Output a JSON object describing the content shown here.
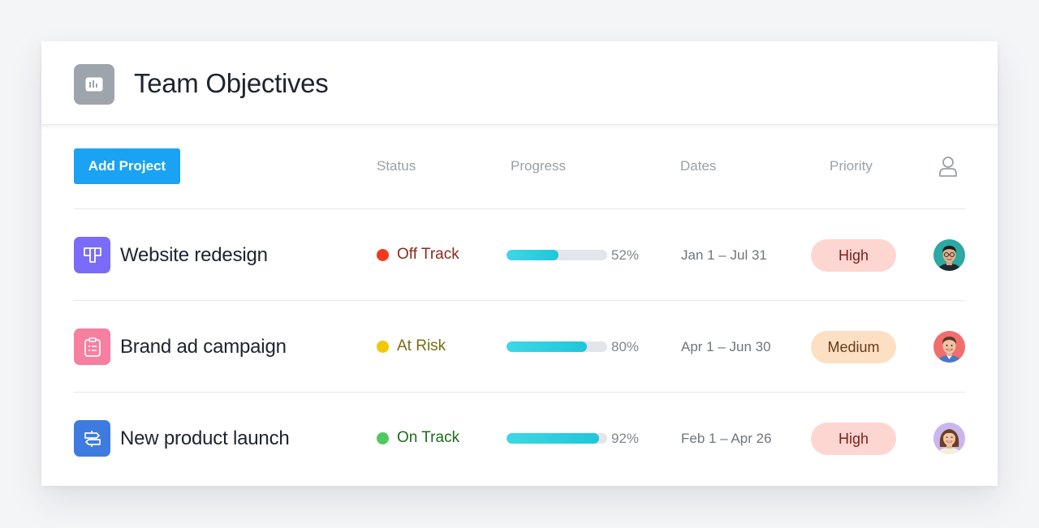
{
  "header": {
    "title": "Team Objectives",
    "icon": "bar-chart-icon"
  },
  "toolbar": {
    "add_project_label": "Add Project"
  },
  "columns": {
    "status": "Status",
    "progress": "Progress",
    "dates": "Dates",
    "priority": "Priority",
    "assignee_icon": "user-icon"
  },
  "colors": {
    "accent": "#1aa3f3",
    "off_track": "#f23a1f",
    "at_risk": "#f2c800",
    "on_track": "#4fc95f",
    "progress_fill": "#2ccfe0",
    "priority_high_bg": "#fdd6d2",
    "priority_medium_bg": "#fde0c4"
  },
  "projects": [
    {
      "name": "Website redesign",
      "icon": "kanban-board-icon",
      "icon_color": "#7a6cf8",
      "status": "Off Track",
      "status_color": "#f23a1f",
      "status_text_color": "#8a2a1b",
      "progress": 52,
      "progress_label": "52%",
      "dates": "Jan 1 – Jul 31",
      "priority": "High",
      "priority_bg": "#fdd6d2",
      "priority_text_color": "#7a1e1a",
      "avatar": "avatar-man-glasses"
    },
    {
      "name": "Brand ad campaign",
      "icon": "clipboard-list-icon",
      "icon_color": "#f77fa0",
      "status": "At Risk",
      "status_color": "#f2c800",
      "status_text_color": "#7d6a12",
      "progress": 80,
      "progress_label": "80%",
      "dates": "Apr 1 – Jun 30",
      "priority": "Medium",
      "priority_bg": "#fde0c4",
      "priority_text_color": "#6a3a12",
      "avatar": "avatar-man-smiling"
    },
    {
      "name": "New product launch",
      "icon": "signpost-icon",
      "icon_color": "#3d7be0",
      "status": "On Track",
      "status_color": "#4fc95f",
      "status_text_color": "#1e6b1c",
      "progress": 92,
      "progress_label": "92%",
      "dates": "Feb 1 – Apr 26",
      "priority": "High",
      "priority_bg": "#fdd6d2",
      "priority_text_color": "#7a1e1a",
      "avatar": "avatar-woman-smiling"
    }
  ]
}
